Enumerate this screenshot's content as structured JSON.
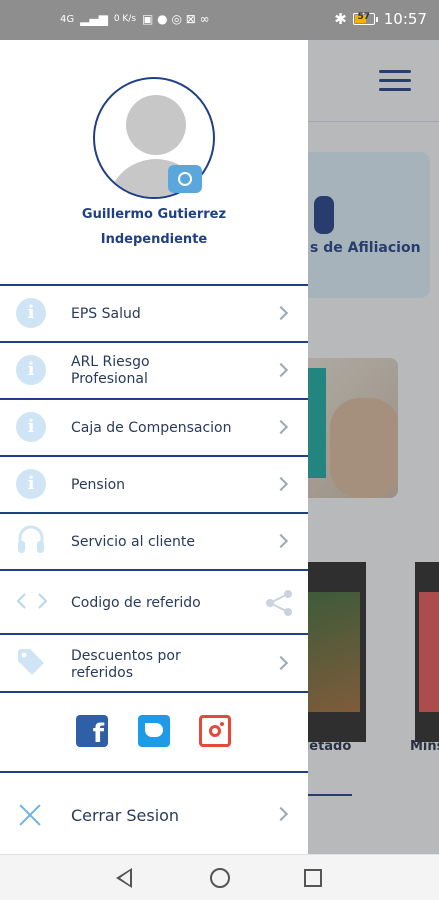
{
  "status_bar": {
    "network": "4G",
    "speed": "0 K/s",
    "battery": "57",
    "time": "10:57"
  },
  "background": {
    "card_label": "s de Afiliacion",
    "video_captions": [
      "uetado",
      "Mins"
    ]
  },
  "drawer": {
    "profile": {
      "name": "Guillermo Gutierrez",
      "type": "Independiente"
    },
    "menu": [
      {
        "label": "EPS Salud",
        "icon": "info-icon"
      },
      {
        "label": "ARL Riesgo Profesional",
        "icon": "info-icon"
      },
      {
        "label": "Caja de Compensacion",
        "icon": "info-icon"
      },
      {
        "label": "Pension",
        "icon": "info-icon"
      },
      {
        "label": "Servicio al cliente",
        "icon": "headset-icon"
      },
      {
        "label": "Codigo de referido",
        "icon": "code-icon"
      },
      {
        "label": "Descuentos por referidos",
        "icon": "tag-icon"
      }
    ],
    "social": [
      "facebook-icon",
      "twitter-icon",
      "instagram-icon"
    ],
    "logout_label": "Cerrar Sesion"
  },
  "colors": {
    "primary": "#1f3f86",
    "accent": "#5aa7dd",
    "instagram": "#e8483a"
  }
}
